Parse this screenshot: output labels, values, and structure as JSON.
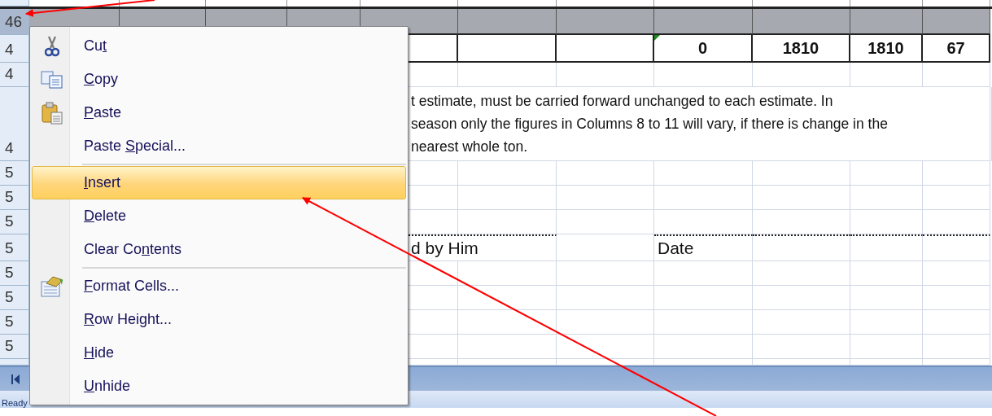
{
  "sheet": {
    "rows": [
      {
        "kind": "selected-header",
        "number": "46",
        "selected": true
      },
      {
        "kind": "totals",
        "number": "4",
        "selected": false,
        "values": [
          "0",
          "1810",
          "1810",
          "67"
        ]
      },
      {
        "kind": "blank",
        "number": "4",
        "selected": false
      },
      {
        "kind": "note",
        "number": "4",
        "selected": false,
        "lines": [
          "t estimate, must be carried forward unchanged to each estimate. In",
          "season only the figures in Columns 8 to 11 will vary, if there is change in the",
          "nearest whole ton."
        ]
      },
      {
        "kind": "blank",
        "number": "5",
        "selected": false
      },
      {
        "kind": "blank",
        "number": "5",
        "selected": false
      },
      {
        "kind": "blank",
        "number": "5",
        "selected": false
      },
      {
        "kind": "signature",
        "number": "5",
        "selected": false,
        "signed": "d by Him",
        "date": "Date"
      },
      {
        "kind": "blank",
        "number": "5",
        "selected": false
      },
      {
        "kind": "blank",
        "number": "5",
        "selected": false
      },
      {
        "kind": "blank",
        "number": "5",
        "selected": false
      },
      {
        "kind": "blank",
        "number": "5",
        "selected": false
      }
    ]
  },
  "context_menu": {
    "items": [
      {
        "before": "Cu",
        "key": "t",
        "selected": false,
        "separator_after": false
      },
      {
        "key": "C",
        "after": "opy",
        "selected": false,
        "separator_after": false
      },
      {
        "key": "P",
        "after": "aste",
        "selected": false,
        "separator_after": false
      },
      {
        "before": "Paste ",
        "key": "S",
        "after": "pecial...",
        "selected": false,
        "separator_after": true
      },
      {
        "key": "I",
        "after": "nsert",
        "selected": true,
        "separator_after": false
      },
      {
        "key": "D",
        "after": "elete",
        "selected": false,
        "separator_after": false
      },
      {
        "before": "Clear Co",
        "key": "n",
        "after": "tents",
        "selected": false,
        "separator_after": true
      },
      {
        "key": "F",
        "after": "ormat Cells...",
        "selected": false,
        "separator_after": false
      },
      {
        "key": "R",
        "after": "ow Height...",
        "selected": false,
        "separator_after": false
      },
      {
        "key": "H",
        "after": "ide",
        "selected": false,
        "separator_after": false
      },
      {
        "key": "U",
        "after": "nhide",
        "selected": false,
        "separator_after": false
      }
    ]
  },
  "status_bar": {
    "text": "Ready"
  }
}
